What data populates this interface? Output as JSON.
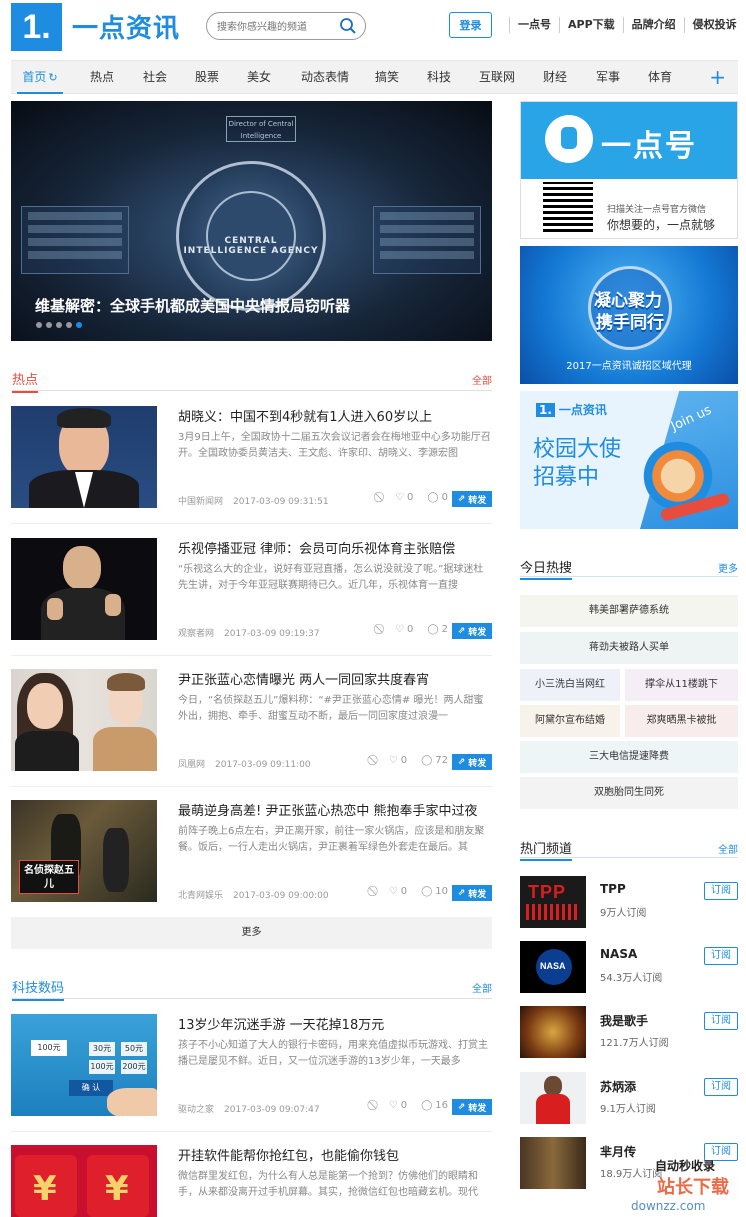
{
  "header": {
    "logo_mark": "1.",
    "logo_text": "一点资讯",
    "search_placeholder": "搜索你感兴趣的频道",
    "login_label": "登录",
    "links": [
      "一点号",
      "APP下载",
      "品牌介绍",
      "侵权投诉"
    ]
  },
  "nav": {
    "items": [
      "首页",
      "热点",
      "社会",
      "股票",
      "美女",
      "动态表情",
      "搞笑",
      "科技",
      "互联网",
      "财经",
      "军事",
      "体育"
    ],
    "active": "首页",
    "plus": "+"
  },
  "banner": {
    "caption": "维基解密：全球手机都成美国中央情报局窃听器",
    "slide_count": 5,
    "active_slide": 5,
    "seal_text": "CENTRAL INTELLIGENCE AGENCY",
    "sign_text": "Director of Central Intelligence"
  },
  "hot_section": {
    "title": "热点",
    "more": "全部",
    "color": "#e84c3d"
  },
  "articles": [
    {
      "title": "胡晓义：中国不到4秒就有1人进入60岁以上",
      "desc": "3月9日上午，全国政协十二届五次会议记者会在梅地亚中心多功能厅召开。全国政协委员黄洁夫、王文彪、许家印、胡晓义、李源宏图",
      "source": "中国新闻网",
      "time": "2017-03-09 09:31:51",
      "likes": "0",
      "comments": "0",
      "share": "转发"
    },
    {
      "title": "乐视停播亚冠 律师：会员可向乐视体育主张赔偿",
      "desc": "“乐视这么大的企业，说好有亚冠直播，怎么说没就没了呢。”据球迷杜先生讲，对于今年亚冠联赛期待已久。近几年，乐视体育一直搜",
      "source": "观察者网",
      "time": "2017-03-09 09:19:37",
      "likes": "0",
      "comments": "2",
      "share": "转发"
    },
    {
      "title": "尹正张蓝心恋情曝光 两人一同回家共度春宵",
      "desc": "今日，“名侦探赵五儿”爆料称：“#尹正张蓝心恋情# 曝光！两人甜蜜外出，拥抱、牵手、甜蜜互动不断，最后一同回家度过浪漫一",
      "source": "凤凰网",
      "time": "2017-03-09 09:11:00",
      "likes": "0",
      "comments": "72",
      "share": "转发"
    },
    {
      "title": "最萌逆身高差! 尹正张蓝心热恋中 熊抱奉手家中过夜",
      "desc": "前阵子晚上6点左右，尹正离开家，前往一家火锅店，应该是和朋友聚餐。饭后，一行人走出火锅店，尹正裹着军绿色外套走在最后。其",
      "source": "北青网娱乐",
      "time": "2017-03-09 09:00:00",
      "likes": "0",
      "comments": "10",
      "share": "转发",
      "thumb_text": "名侦探赵五儿"
    }
  ],
  "more_label": "更多",
  "tech_section": {
    "title": "科技数码",
    "more": "全部",
    "color": "#1e8ce0"
  },
  "tech_articles": [
    {
      "title": "13岁少年沉迷手游 一天花掉18万元",
      "desc": "孩子不小心知道了大人的银行卡密码，用来充值虚拟币玩游戏、打赏主播已是屡见不鲜。近日，又一位沉迷手游的13岁少年，一天最多",
      "source": "驱动之家",
      "time": "2017-03-09 09:07:47",
      "likes": "0",
      "comments": "16",
      "share": "转发",
      "thumb_values": [
        "100元",
        "30元",
        "50元",
        "100元",
        "200元",
        "确 认"
      ]
    },
    {
      "title": "开挂软件能帮你抢红包，也能偷你钱包",
      "desc": "微信群里发红包，为什么有人总是能第一个抢到？仿佛他们的眼睛和手，从来都没离开过手机屏幕。其实，抢微信红包也暗藏玄机。现代",
      "thumb_char": "¥"
    }
  ],
  "sidebar": {
    "ad1": {
      "brand": "一点号",
      "qr_caption": "扫描关注一点号官方微信",
      "slogan": "你想要的，一点就够"
    },
    "ad2": {
      "line1": "凝心聚力",
      "line2": "携手同行",
      "caption": "2017一点资讯诚招区域代理"
    },
    "ad3": {
      "brand_mark": "1.",
      "brand": "一点资讯",
      "line1": "校园大使",
      "line2": "招募中",
      "join": "Join us"
    },
    "hot_search": {
      "title": "今日热搜",
      "more": "更多",
      "tags": [
        {
          "label": "韩美部署萨德系统",
          "color": "#f3f5ee"
        },
        {
          "label": "蒋劲夫被路人买单",
          "color": "#eef3f3"
        },
        {
          "label": "小三洗白当网红",
          "color": "#eef1f8"
        },
        {
          "label": "撑伞从11楼跳下",
          "color": "#f6eef6"
        },
        {
          "label": "阿黛尔宣布结婚",
          "color": "#f7f2ea"
        },
        {
          "label": "郑爽晒黑卡被批",
          "color": "#f8ecec"
        },
        {
          "label": "三大电信提速降费",
          "color": "#edf5f6"
        },
        {
          "label": "双胞胎同生同死",
          "color": "#f3f3f3"
        }
      ]
    },
    "channels": {
      "title": "热门频道",
      "more": "全部",
      "items": [
        {
          "name": "TPP",
          "subs": "9万人订阅",
          "btn": "订阅"
        },
        {
          "name": "NASA",
          "subs": "54.3万人订阅",
          "btn": "订阅"
        },
        {
          "name": "我是歌手",
          "subs": "121.7万人订阅",
          "btn": "订阅"
        },
        {
          "name": "苏炳添",
          "subs": "9.1万人订阅",
          "btn": "订阅"
        },
        {
          "name": "芈月传",
          "subs": "18.9万人订阅",
          "btn": "订阅"
        }
      ]
    }
  },
  "watermark": {
    "line1": "自动秒收录",
    "line2": "站长下载",
    "line3": "downzz.com"
  },
  "colors": {
    "accent": "#1e8ce0",
    "hot": "#e84c3d"
  }
}
